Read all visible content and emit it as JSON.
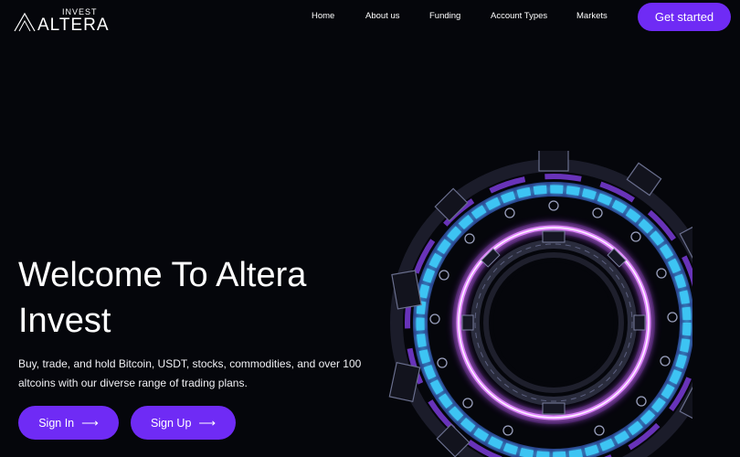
{
  "brand": {
    "top": "INVEST",
    "word": "ALTERA"
  },
  "nav": {
    "items": [
      "Home",
      "About us",
      "Funding",
      "Account Types",
      "Markets"
    ],
    "cta": "Get started"
  },
  "hero": {
    "title_line1": "Welcome To Altera",
    "title_line2": "Invest",
    "subtitle_line1": "Buy, trade, and hold Bitcoin, USDT, stocks, commodities, and over 100",
    "subtitle_line2": "altcoins with our diverse range of trading plans.",
    "buttons": {
      "signin": "Sign In",
      "signup": "Sign Up"
    }
  },
  "colors": {
    "background": "#05060b",
    "accent": "#6f2bf5",
    "ring_purple": "#c05cff",
    "ring_cyan": "#3fd3ff"
  },
  "icons": {
    "arrow": "arrow-right-icon",
    "art": "portal-ring-illustration"
  }
}
